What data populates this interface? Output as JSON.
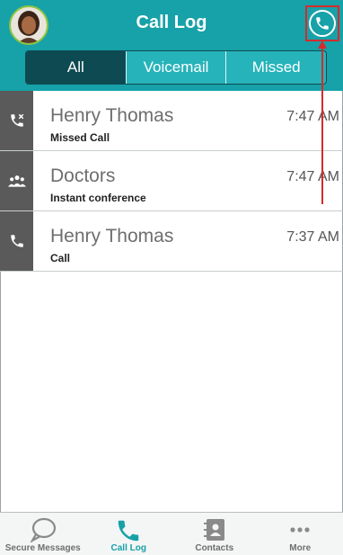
{
  "header": {
    "title": "Call Log",
    "accent": "#17a1a8"
  },
  "filters": [
    {
      "label": "All",
      "selected": true
    },
    {
      "label": "Voicemail",
      "selected": false
    },
    {
      "label": "Missed",
      "selected": false
    }
  ],
  "calls": [
    {
      "name": "Henry Thomas",
      "type": "Missed Call",
      "time": "7:47 AM",
      "icon": "missed-call-icon"
    },
    {
      "name": "Doctors",
      "type": "Instant conference",
      "time": "7:47 AM",
      "icon": "conference-icon"
    },
    {
      "name": "Henry Thomas",
      "type": "Call",
      "time": "7:37 AM",
      "icon": "phone-icon"
    }
  ],
  "tabs": [
    {
      "label": "Secure Messages",
      "icon": "chat-bubble-icon",
      "active": false
    },
    {
      "label": "Call Log",
      "icon": "phone-icon",
      "active": true
    },
    {
      "label": "Contacts",
      "icon": "contacts-book-icon",
      "active": false
    },
    {
      "label": "More",
      "icon": "more-dots-icon",
      "active": false
    }
  ],
  "colors": {
    "header": "#17a1a8",
    "segment_selected": "#0e4a51",
    "annotation": "#d62b2b"
  }
}
